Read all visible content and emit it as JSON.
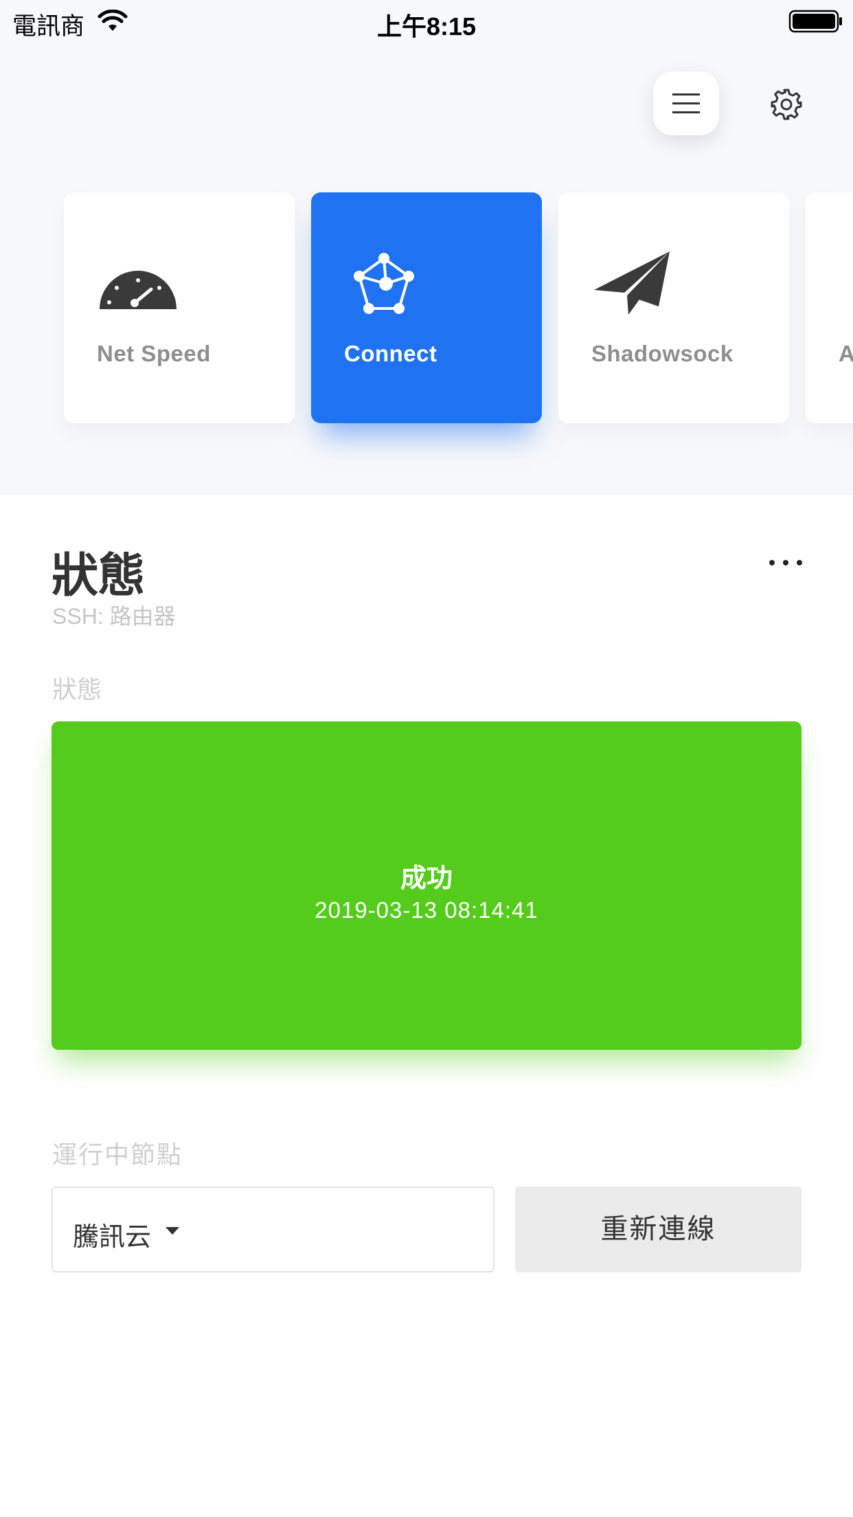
{
  "status_bar": {
    "carrier": "電訊商",
    "time": "上午8:15"
  },
  "cards": [
    {
      "label": "Net Speed",
      "icon": "speedometer-icon",
      "active": false
    },
    {
      "label": "Connect",
      "icon": "network-pentagon-icon",
      "active": true
    },
    {
      "label": "Shadowsock",
      "icon": "paper-plane-icon",
      "active": false
    },
    {
      "label": "A",
      "icon": "partial-icon",
      "active": false
    }
  ],
  "section": {
    "title": "狀態",
    "subtitle": "SSH: 路由器"
  },
  "status": {
    "label": "狀態",
    "result": "成功",
    "timestamp": "2019-03-13 08:14:41",
    "color": "#53cc1b"
  },
  "node": {
    "label": "運行中節點",
    "selected": "騰訊云",
    "reconnect_label": "重新連線"
  },
  "colors": {
    "accent": "#1f73f2",
    "success": "#53cc1b"
  }
}
